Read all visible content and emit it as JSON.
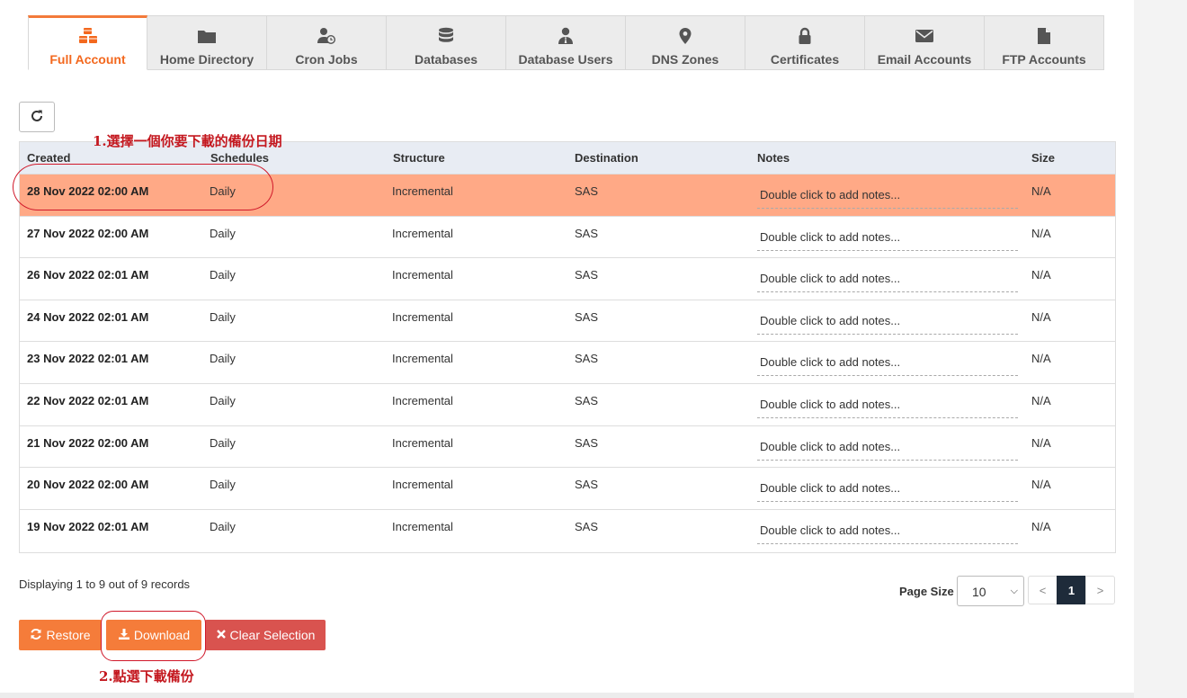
{
  "tabs": [
    {
      "label": "Full Account",
      "icon": "cubes-icon",
      "active": true
    },
    {
      "label": "Home Directory",
      "icon": "folder-icon",
      "active": false
    },
    {
      "label": "Cron Jobs",
      "icon": "user-clock-icon",
      "active": false
    },
    {
      "label": "Databases",
      "icon": "database-icon",
      "active": false
    },
    {
      "label": "Database Users",
      "icon": "user-tie-icon",
      "active": false
    },
    {
      "label": "DNS Zones",
      "icon": "map-marker-icon",
      "active": false
    },
    {
      "label": "Certificates",
      "icon": "lock-icon",
      "active": false
    },
    {
      "label": "Email Accounts",
      "icon": "envelope-icon",
      "active": false
    },
    {
      "label": "FTP Accounts",
      "icon": "file-icon",
      "active": false
    }
  ],
  "table": {
    "headers": {
      "created": "Created",
      "schedules": "Schedules",
      "structure": "Structure",
      "destination": "Destination",
      "notes": "Notes",
      "size": "Size"
    },
    "rows": [
      {
        "created": "28 Nov 2022 02:00 AM",
        "schedule": "Daily",
        "structure": "Incremental",
        "destination": "SAS",
        "notes": "Double click to add notes...",
        "size": "N/A",
        "selected": true
      },
      {
        "created": "27 Nov 2022 02:00 AM",
        "schedule": "Daily",
        "structure": "Incremental",
        "destination": "SAS",
        "notes": "Double click to add notes...",
        "size": "N/A",
        "selected": false
      },
      {
        "created": "26 Nov 2022 02:01 AM",
        "schedule": "Daily",
        "structure": "Incremental",
        "destination": "SAS",
        "notes": "Double click to add notes...",
        "size": "N/A",
        "selected": false
      },
      {
        "created": "24 Nov 2022 02:01 AM",
        "schedule": "Daily",
        "structure": "Incremental",
        "destination": "SAS",
        "notes": "Double click to add notes...",
        "size": "N/A",
        "selected": false
      },
      {
        "created": "23 Nov 2022 02:01 AM",
        "schedule": "Daily",
        "structure": "Incremental",
        "destination": "SAS",
        "notes": "Double click to add notes...",
        "size": "N/A",
        "selected": false
      },
      {
        "created": "22 Nov 2022 02:01 AM",
        "schedule": "Daily",
        "structure": "Incremental",
        "destination": "SAS",
        "notes": "Double click to add notes...",
        "size": "N/A",
        "selected": false
      },
      {
        "created": "21 Nov 2022 02:00 AM",
        "schedule": "Daily",
        "structure": "Incremental",
        "destination": "SAS",
        "notes": "Double click to add notes...",
        "size": "N/A",
        "selected": false
      },
      {
        "created": "20 Nov 2022 02:00 AM",
        "schedule": "Daily",
        "structure": "Incremental",
        "destination": "SAS",
        "notes": "Double click to add notes...",
        "size": "N/A",
        "selected": false
      },
      {
        "created": "19 Nov 2022 02:01 AM",
        "schedule": "Daily",
        "structure": "Incremental",
        "destination": "SAS",
        "notes": "Double click to add notes...",
        "size": "N/A",
        "selected": false
      }
    ]
  },
  "footer": {
    "records_text": "Displaying 1 to 9 out of 9 records",
    "page_size_label": "Page Size",
    "page_size_value": "10",
    "pager": {
      "prev": "<",
      "current": "1",
      "next": ">"
    }
  },
  "actions": {
    "restore_label": "Restore",
    "download_label": "Download",
    "clear_label": "Clear Selection"
  },
  "annotations": {
    "step1": "1.選擇一個你要下載的備份日期",
    "step2": "2.點選下載備份"
  },
  "colors": {
    "accent": "#f57c3a",
    "selected_row": "#ffa986",
    "danger": "#d9534f",
    "annotation": "#c4181f"
  }
}
